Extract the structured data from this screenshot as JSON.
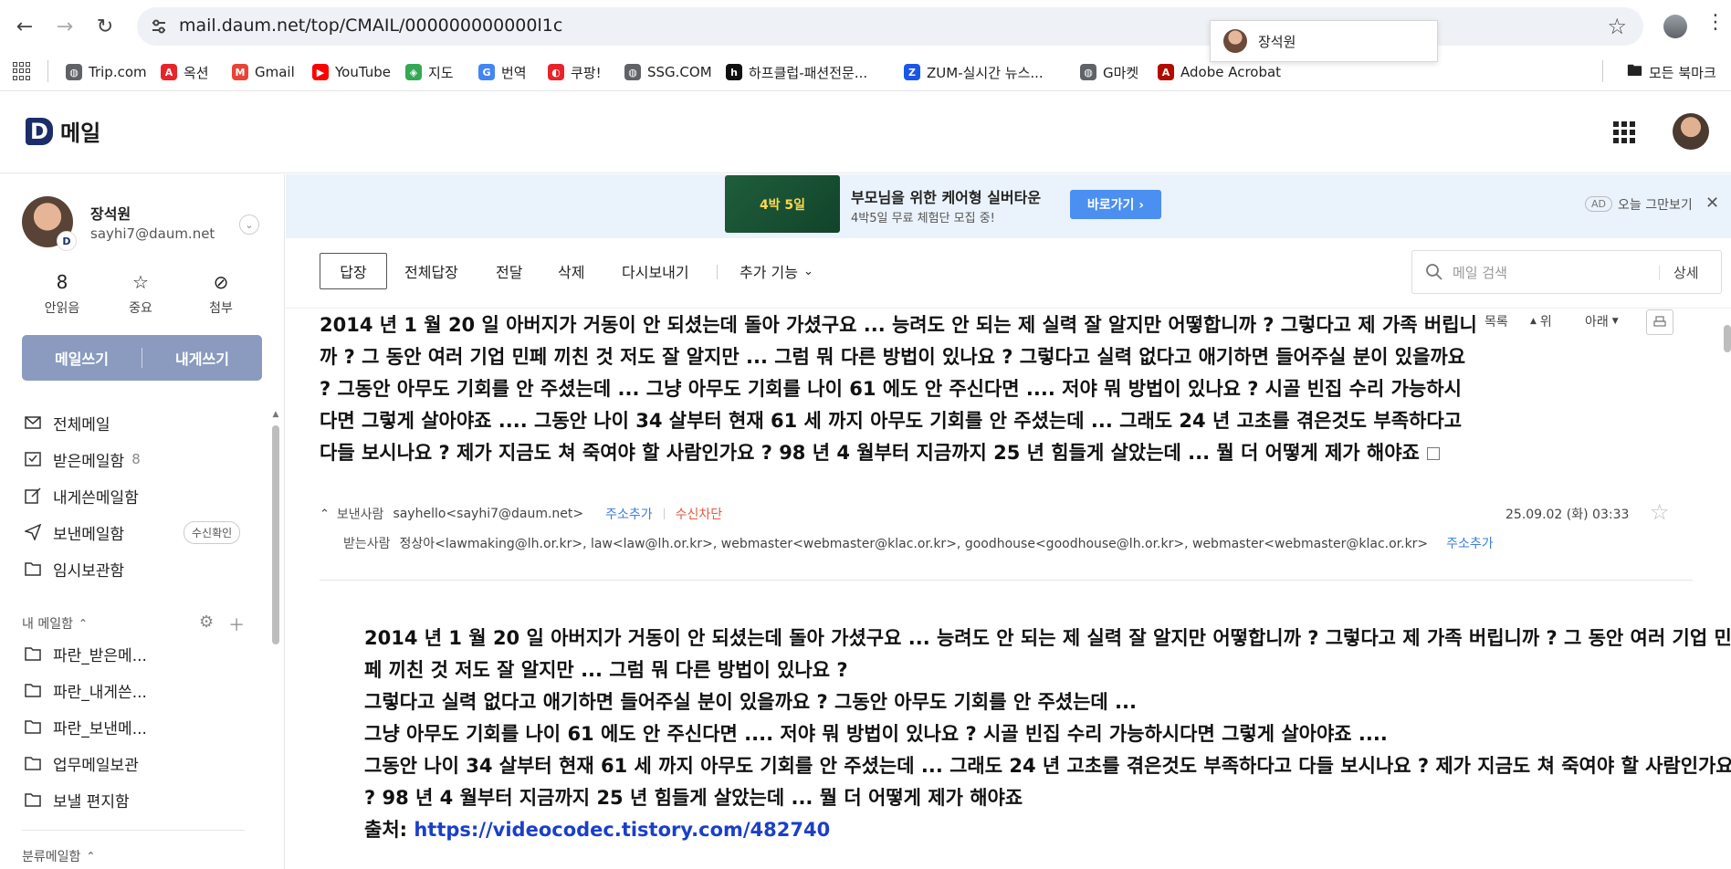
{
  "browser": {
    "url": "mail.daum.net/top/CMAIL/000000000000l1c",
    "profile_popup_name": "장석원",
    "bookmarks": [
      {
        "label": "Trip.com",
        "color": "#5f6368"
      },
      {
        "label": "옥션",
        "color": "#e8232a"
      },
      {
        "label": "Gmail",
        "color": "#ea4335"
      },
      {
        "label": "YouTube",
        "color": "#ff0000"
      },
      {
        "label": "지도",
        "color": "#34a853"
      },
      {
        "label": "번역",
        "color": "#4285f4"
      },
      {
        "label": "쿠팡!",
        "color": "#e8232a"
      },
      {
        "label": "SSG.COM",
        "color": "#5f6368"
      },
      {
        "label": "하프클럽-패션전문...",
        "color": "#111111"
      },
      {
        "label": "ZUM-실시간 뉴스...",
        "color": "#1a56e8"
      },
      {
        "label": "G마켓",
        "color": "#5f6368"
      },
      {
        "label": "Adobe Acrobat",
        "color": "#b30b00"
      }
    ],
    "all_bookmarks": "모든 북마크"
  },
  "header": {
    "logo_letter": "D",
    "title": "메일"
  },
  "user": {
    "name": "장석원",
    "email": "sayhi7@daum.net",
    "badge": "D"
  },
  "stats": [
    {
      "value": "8",
      "label": "안읽음"
    },
    {
      "value": "☆",
      "label": "중요"
    },
    {
      "value": "⊘",
      "label": "첨부"
    }
  ],
  "write": {
    "compose": "메일쓰기",
    "to_me": "내게쓰기"
  },
  "folders": [
    {
      "label": "전체메일",
      "count": ""
    },
    {
      "label": "받은메일함",
      "count": "8"
    },
    {
      "label": "내게쓴메일함",
      "count": ""
    },
    {
      "label": "보낸메일함",
      "count": "",
      "chip": "수신확인"
    },
    {
      "label": "임시보관함",
      "count": ""
    }
  ],
  "my_folders_title": "내 메일함",
  "my_folders": [
    {
      "label": "파란_받은메..."
    },
    {
      "label": "파란_내게쓴..."
    },
    {
      "label": "파란_보낸메..."
    },
    {
      "label": "업무메일보관"
    },
    {
      "label": "보낼 편지함"
    }
  ],
  "category_title": "분류메일함",
  "ad": {
    "image_text": "4박 5일",
    "title": "부모님을 위한 케어형 실버타운",
    "subtitle": "4박5일 무료 체험단 모집 중!",
    "button": "바로가기",
    "tag": "AD",
    "dismiss": "오늘 그만보기"
  },
  "toolbar": {
    "reply": "답장",
    "reply_all": "전체답장",
    "forward": "전달",
    "delete": "삭제",
    "resend": "다시보내기",
    "more": "추가 기능",
    "search_placeholder": "메일 검색",
    "advanced": "상세"
  },
  "mail": {
    "subject": "2014 년 1 월 20 일 아버지가 거동이 안 되셨는데 돌아 가셨구요 ... 능려도 안 되는 제 실력 잘 알지만 어떻합니까 ? 그렇다고 제 가족 버립니까 ? 그 동안 여러 기업 민페 끼친 것 저도 잘 알지만 ... 그럼 뭐 다른 방법이 있나요 ? 그렇다고 실력 없다고 애기하면 들어주실 분이 있을까요 ? 그동안 아무도 기회를 안 주셨는데 ... 그냥 아무도 기회를 나이 61 에도 안 주신다면 .... 저야 뭐 방법이 있나요 ? 시골 빈집 수리 가능하시다면 그렇게 살아야죠 .... 그동안 나이 34 살부터 현재 61 세 까지 아무도 기회를 안 주셨는데 ... 그래도 24 년 고초를 겪은것도 부족하다고 다들 보시나요 ? 제가 지금도 쳐 죽여야 할 사람인가요 ? 98 년 4 월부터 지금까지 25 년 힘들게 살았는데 ... 뭘 더 어떻게 제가 해야죠",
    "list": "목록",
    "up": "위",
    "down": "아래",
    "sender_label": "보낸사람",
    "sender": "sayhello<sayhi7@daum.net>",
    "add_contact": "주소추가",
    "block": "수신차단",
    "date": "25.09.02 (화) 03:33",
    "recipient_label": "받는사람",
    "recipients": "정상아<lawmaking@lh.or.kr>, law<law@lh.or.kr>, webmaster<webmaster@klac.or.kr>, goodhouse<goodhouse@lh.or.kr>, webmaster<webmaster@klac.or.kr>",
    "add_contact2": "주소추가",
    "body": [
      "2014 년 1 월 20 일 아버지가 거동이 안 되셨는데 돌아 가셨구요 ... 능려도 안 되는 제 실력 잘 알지만 어떻합니까 ? 그렇다고 제 가족 버립니까 ? 그 동안 여러 기업 민페 끼친 것 저도 잘 알지만 ... 그럼 뭐 다른 방법이 있나요 ?",
      "그렇다고 실력 없다고 애기하면 들어주실 분이 있을까요 ? 그동안 아무도 기회를 안 주셨는데 ...",
      "그냥 아무도 기회를 나이 61 에도 안 주신다면 .... 저야 뭐 방법이 있나요 ? 시골 빈집 수리 가능하시다면 그렇게 살아야죠 ....",
      "그동안 나이 34 살부터 현재 61 세 까지 아무도 기회를 안 주셨는데 ... 그래도 24 년 고초를 겪은것도 부족하다고 다들 보시나요 ? 제가 지금도 쳐 죽여야 할 사람인가요 ? 98 년 4 월부터 지금까지 25 년 힘들게 살았는데 ... 뭘 더 어떻게 제가 해야죠"
    ],
    "source_label": "출처: ",
    "source_link": "https://videocodec.tistory.com/482740"
  }
}
